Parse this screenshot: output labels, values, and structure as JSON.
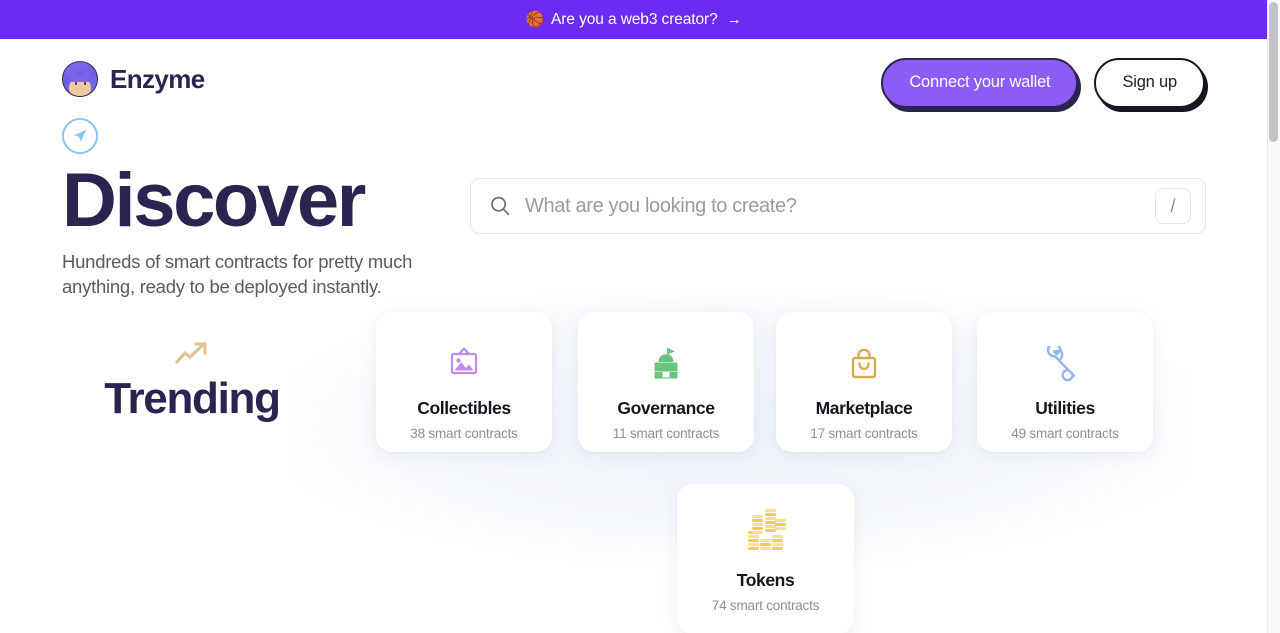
{
  "banner": {
    "emoji": "🏀",
    "text": "Are you a web3 creator?",
    "arrow": "→",
    "close_label": "close-banner",
    "background": "#6C2BF2"
  },
  "header": {
    "brand_name": "Enzyme",
    "connect_wallet_label": "Connect your wallet",
    "sign_up_label": "Sign up",
    "primary_color": "#8B5CF6"
  },
  "hero": {
    "title": "Discover",
    "subtitle": "Hundreds of smart contracts for pretty much anything, ready to be deployed instantly."
  },
  "search": {
    "value": "",
    "placeholder": "What are you looking to create?",
    "shortcut": "/"
  },
  "trending": {
    "label": "Trending"
  },
  "categories": [
    {
      "title": "Collectibles",
      "count": "38 smart contracts",
      "icon": "picture-frame-icon",
      "color": "#C08BEE"
    },
    {
      "title": "Governance",
      "count": "11 smart contracts",
      "icon": "capitol-building-icon",
      "color": "#6BC47E"
    },
    {
      "title": "Marketplace",
      "count": "17 smart contracts",
      "icon": "shopping-bag-icon",
      "color": "#D9A94E"
    },
    {
      "title": "Utilities",
      "count": "49 smart contracts",
      "icon": "wrench-icon",
      "color": "#92B4EE"
    },
    {
      "title": "Tokens",
      "count": "74 smart contracts",
      "icon": "coin-stack-icon",
      "color": "#F2CE4B"
    }
  ]
}
